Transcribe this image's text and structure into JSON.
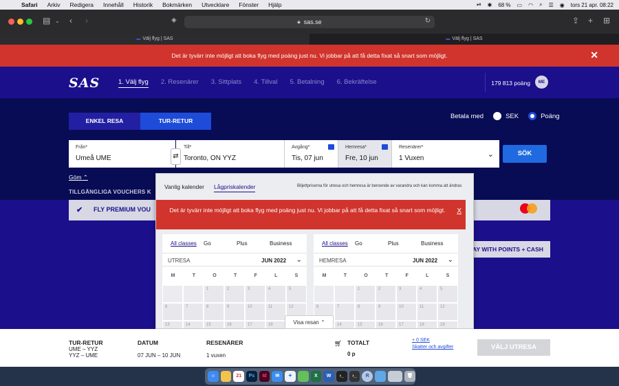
{
  "menubar": {
    "app": "Safari",
    "items": [
      "Arkiv",
      "Redigera",
      "Innehåll",
      "Historik",
      "Bokmärken",
      "Utvecklare",
      "Fönster",
      "Hjälp"
    ],
    "battery": "68 %",
    "datetime": "tors 21 apr.  08:22"
  },
  "browser": {
    "url": "sas.se",
    "tabs": [
      "Välj flyg | SAS",
      "Välj flyg | SAS"
    ]
  },
  "alert_top": {
    "text": "Det är tyvärr inte möjligt att boka flyg med poäng just nu. Vi jobbar på att få detta fixat så snart som möjligt.",
    "close": "✕"
  },
  "header": {
    "logo": "SAS",
    "steps": [
      "1. Välj flyg",
      "2. Resenärer",
      "3. Sittplats",
      "4. Tillval",
      "5. Betalning",
      "6. Bekräftelse"
    ],
    "points": "179 813 poäng",
    "avatar": "ME"
  },
  "booking": {
    "trip_one_way": "ENKEL RESA",
    "trip_round": "TUR-RETUR",
    "pay_with": "Betala med",
    "pay_options": [
      "SEK",
      "Poäng"
    ],
    "pay_selected": "Poäng",
    "from_label": "Från*",
    "from_value": "Umeå UME",
    "to_label": "Till*",
    "to_value": "Toronto, ON YYZ",
    "dep_label": "Avgång*",
    "dep_value": "Tis, 07 jun",
    "ret_label": "Hemresa*",
    "ret_value": "Fre, 10 jun",
    "pax_label": "Resenärer*",
    "pax_value": "1 Vuxen",
    "search": "SÖK",
    "hide": "Göm",
    "vouchers": "TILLGÄNGLIGA VOUCHERS K"
  },
  "main": {
    "fly_premium": "FLY PREMIUM VOU",
    "mastercard": "mastercard",
    "pay_points_cash": "PAY WITH POINTS + CASH"
  },
  "popup": {
    "tab_regular": "Vanlig kalender",
    "tab_low": "Lågpriskalender",
    "note": "Biljettpriserna för utresa och hemresa är beroende av varandra och kan komma att ändras",
    "alert": "Det är tyvärr inte möjligt att boka flyg med poäng just nu. Vi jobbar på att få detta fixat så snart som möjligt.",
    "alert_close": "X",
    "classes": [
      "All classes",
      "Go",
      "Plus",
      "Business"
    ],
    "outbound": {
      "dir": "UTRESA",
      "month": "JUN 2022"
    },
    "return": {
      "dir": "HEMRESA",
      "month": "JUN 2022"
    },
    "weekdays": [
      "M",
      "T",
      "O",
      "T",
      "F",
      "L",
      "S"
    ],
    "out_days": [
      "",
      "",
      "1",
      "2",
      "3",
      "4",
      "5",
      "6",
      "7",
      "8",
      "9",
      "10",
      "11",
      "12",
      "13",
      "14",
      "15",
      "16",
      "17",
      "18",
      "19"
    ],
    "ret_days": [
      "",
      "",
      "1",
      "2",
      "3",
      "4",
      "5",
      "6",
      "7",
      "8",
      "9",
      "10",
      "11",
      "12",
      "13",
      "14",
      "15",
      "16",
      "17",
      "18",
      "19"
    ],
    "show_trip": "Visa resan"
  },
  "footer": {
    "trip_label": "TUR-RETUR",
    "leg1": "UME – YYZ",
    "leg2": "YYZ – UME",
    "date_label": "DATUM",
    "date_value": "07 JUN – 10 JUN",
    "pax_label": "RESENÄRER",
    "pax_value": "1 vuxen",
    "total_label": "TOTALT",
    "total_value": "0 p",
    "sek": "+ 0 SEK",
    "tax": "Skatter och avgifter",
    "select": "VÄLJ UTRESA"
  },
  "dock": {
    "icons": [
      "finder-icon",
      "notes-icon",
      "calendar-icon",
      "photoshop-icon",
      "indesign-icon",
      "mail-icon",
      "safari-icon",
      "maps-icon",
      "excel-icon",
      "word-icon",
      "terminal-icon",
      "terminal2-icon",
      "r-icon",
      "folder-icon",
      "toolbar-icon",
      "trash-icon"
    ],
    "calendar_day": "21",
    "ps": "Ps",
    "id": "Id",
    "r": "R"
  }
}
